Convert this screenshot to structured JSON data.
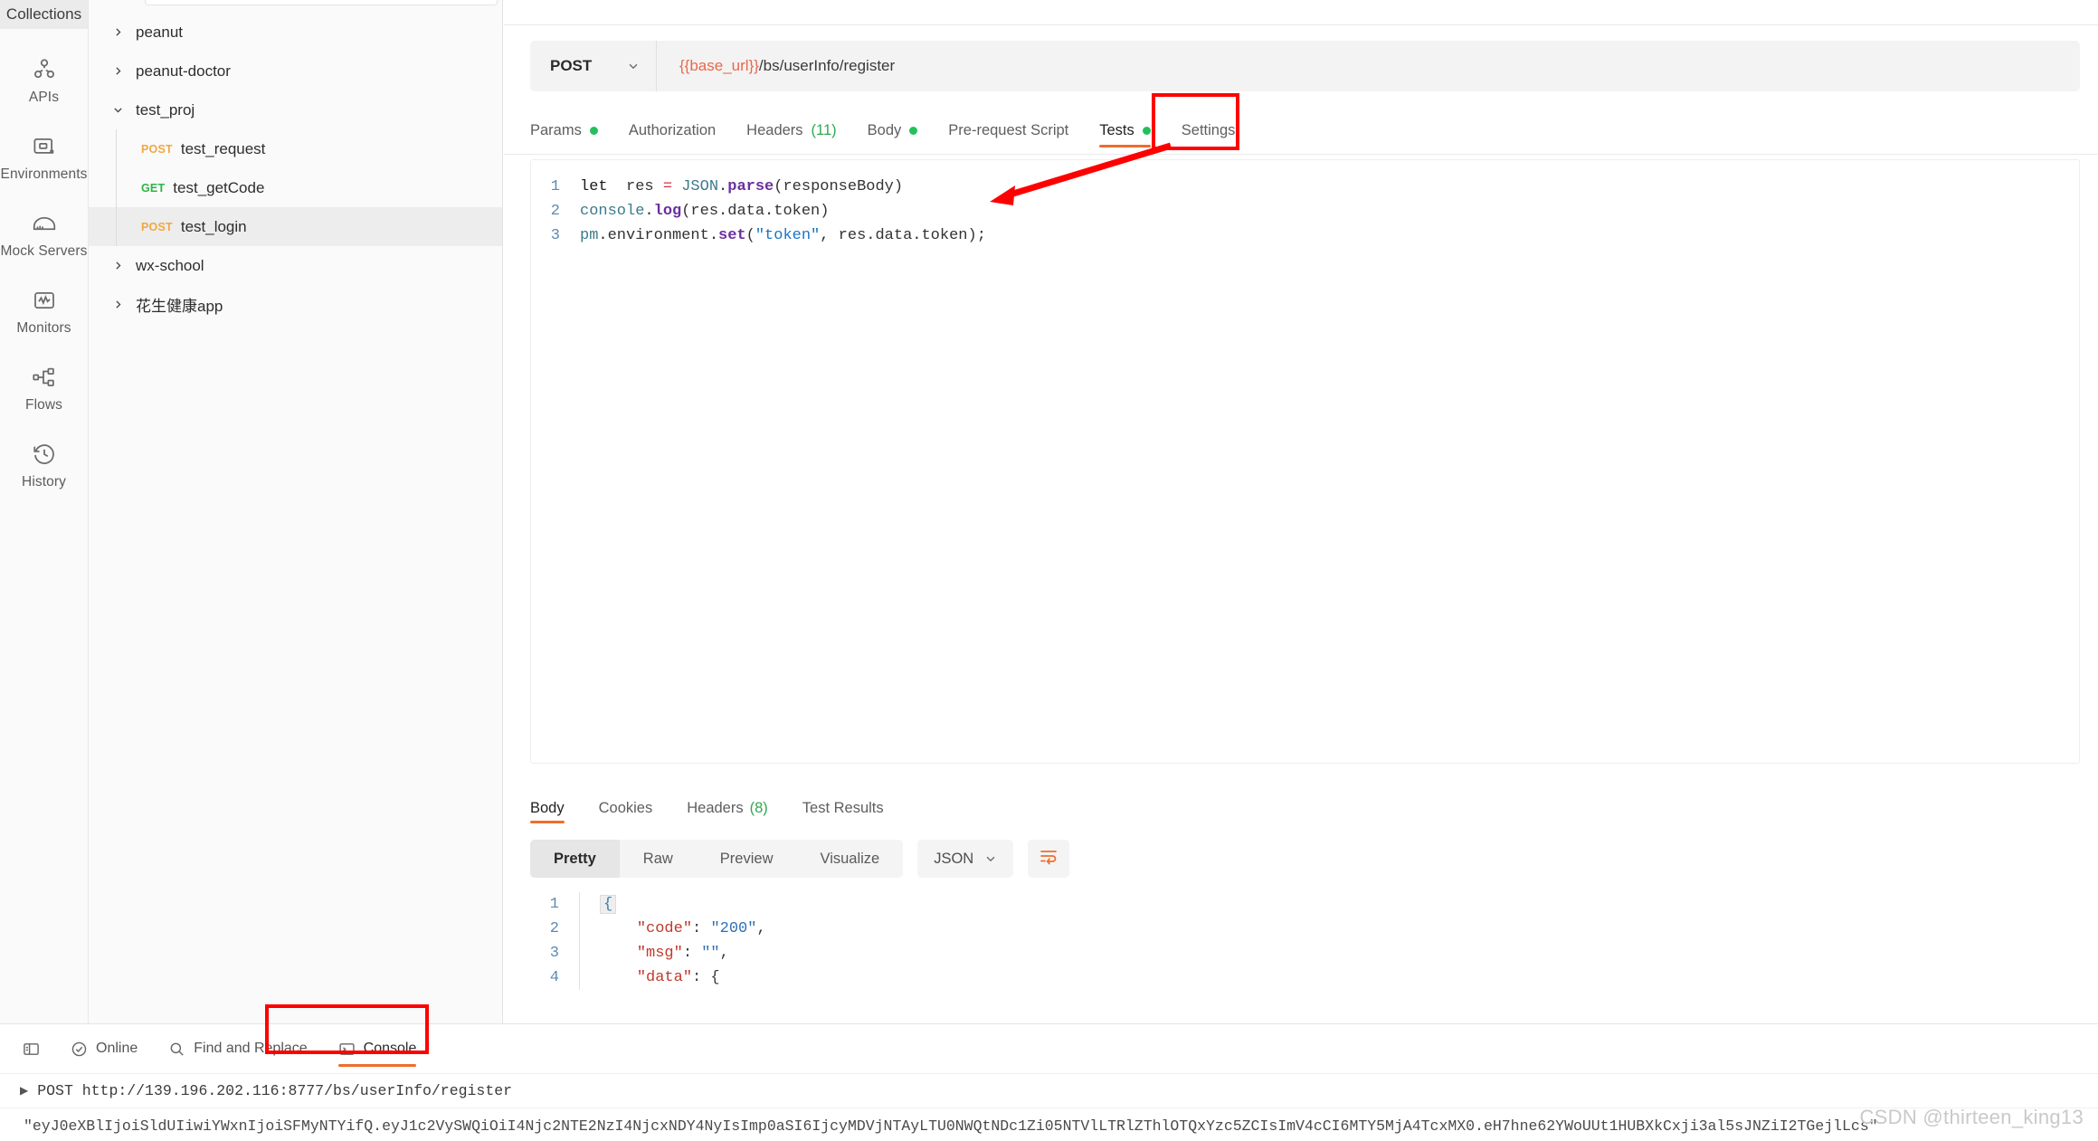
{
  "rail": {
    "header": "Collections",
    "items": [
      {
        "label": "APIs",
        "icon": "apis-icon"
      },
      {
        "label": "Environments",
        "icon": "environments-icon"
      },
      {
        "label": "Mock Servers",
        "icon": "mock-servers-icon"
      },
      {
        "label": "Monitors",
        "icon": "monitors-icon"
      },
      {
        "label": "Flows",
        "icon": "flows-icon"
      },
      {
        "label": "History",
        "icon": "history-icon"
      }
    ]
  },
  "sidebar": {
    "tree": [
      {
        "label": "peanut",
        "type": "collection",
        "expanded": false
      },
      {
        "label": "peanut-doctor",
        "type": "collection",
        "expanded": false
      },
      {
        "label": "test_proj",
        "type": "collection",
        "expanded": true
      },
      {
        "label": "test_request",
        "type": "request",
        "method": "POST",
        "selected": false
      },
      {
        "label": "test_getCode",
        "type": "request",
        "method": "GET",
        "selected": false
      },
      {
        "label": "test_login",
        "type": "request",
        "method": "POST",
        "selected": true
      },
      {
        "label": "wx-school",
        "type": "collection",
        "expanded": false
      },
      {
        "label": "花生健康app",
        "type": "collection",
        "expanded": false
      }
    ]
  },
  "request": {
    "method": "POST",
    "url_variable": "{{base_url}}",
    "url_path": "/bs/userInfo/register",
    "tabs": [
      {
        "label": "Params",
        "badge": "dot",
        "active": false
      },
      {
        "label": "Authorization",
        "badge": "none",
        "active": false
      },
      {
        "label": "Headers",
        "count": "(11)",
        "badge": "count",
        "active": false
      },
      {
        "label": "Body",
        "badge": "dot",
        "active": false
      },
      {
        "label": "Pre-request Script",
        "badge": "none",
        "active": false
      },
      {
        "label": "Tests",
        "badge": "dot",
        "active": true
      },
      {
        "label": "Settings",
        "badge": "none",
        "active": false
      }
    ],
    "script_lines": [
      {
        "n": "1",
        "tokens": [
          {
            "t": "let  ",
            "c": "k-kw"
          },
          {
            "t": "res ",
            "c": "k-pl"
          },
          {
            "t": "= ",
            "c": "k-op"
          },
          {
            "t": "JSON",
            "c": "k-obj"
          },
          {
            "t": ".",
            "c": "k-pl"
          },
          {
            "t": "parse",
            "c": "k-fn"
          },
          {
            "t": "(responseBody)",
            "c": "k-pl"
          }
        ]
      },
      {
        "n": "2",
        "tokens": [
          {
            "t": "console",
            "c": "k-obj"
          },
          {
            "t": ".",
            "c": "k-pl"
          },
          {
            "t": "log",
            "c": "k-fn"
          },
          {
            "t": "(res.data.token)",
            "c": "k-pl"
          }
        ]
      },
      {
        "n": "3",
        "tokens": [
          {
            "t": "pm",
            "c": "k-obj"
          },
          {
            "t": ".environment.",
            "c": "k-pl"
          },
          {
            "t": "set",
            "c": "k-fn"
          },
          {
            "t": "(",
            "c": "k-pl"
          },
          {
            "t": "\"token\"",
            "c": "k-str"
          },
          {
            "t": ", res.data.token);",
            "c": "k-pl"
          }
        ]
      }
    ]
  },
  "response": {
    "tabs": [
      {
        "label": "Body",
        "active": true
      },
      {
        "label": "Cookies",
        "active": false
      },
      {
        "label": "Headers",
        "count": "(8)",
        "active": false
      },
      {
        "label": "Test Results",
        "active": false
      }
    ],
    "view_modes": [
      "Pretty",
      "Raw",
      "Preview",
      "Visualize"
    ],
    "active_view_mode": "Pretty",
    "format": "JSON",
    "wrap_icon": "word-wrap-icon",
    "body_lines": [
      {
        "n": "1",
        "tokens": [
          {
            "t": "{",
            "c": "fold"
          }
        ]
      },
      {
        "n": "2",
        "tokens": [
          {
            "t": "    ",
            "c": "j-pun"
          },
          {
            "t": "\"code\"",
            "c": "j-key"
          },
          {
            "t": ": ",
            "c": "j-pun"
          },
          {
            "t": "\"200\"",
            "c": "j-str"
          },
          {
            "t": ",",
            "c": "j-pun"
          }
        ]
      },
      {
        "n": "3",
        "tokens": [
          {
            "t": "    ",
            "c": "j-pun"
          },
          {
            "t": "\"msg\"",
            "c": "j-key"
          },
          {
            "t": ": ",
            "c": "j-pun"
          },
          {
            "t": "\"\"",
            "c": "j-str"
          },
          {
            "t": ",",
            "c": "j-pun"
          }
        ]
      },
      {
        "n": "4",
        "tokens": [
          {
            "t": "    ",
            "c": "j-pun"
          },
          {
            "t": "\"data\"",
            "c": "j-key"
          },
          {
            "t": ": {",
            "c": "j-pun"
          }
        ]
      }
    ]
  },
  "statusbar": {
    "items": [
      {
        "label": "",
        "icon": "sidebar-toggle-icon",
        "active": false
      },
      {
        "label": "Online",
        "icon": "online-check-icon",
        "active": false
      },
      {
        "label": "Find and Replace",
        "icon": "search-icon",
        "active": false
      },
      {
        "label": "Console",
        "icon": "console-icon",
        "active": true
      }
    ]
  },
  "console": {
    "request_line": "POST http://139.196.202.116:8777/bs/userInfo/register",
    "token_line": "\"eyJ0eXBlIjoiSldUIiwiYWxnIjoiSFMyNTYifQ.eyJ1c2VySWQiOiI4Njc2NTE2NzI4NjcxNDY4NyIsImp0aSI6IjcyMDVjNTAyLTU0NWQtNDc1Zi05NTVlLTRlZThlOTQxYzc5ZCIsImV4cCI6MTY5MjA4TcxMX0.eH7hne62YWoUUt1HUBXkCxji3al5sJNZiI2TGejlLcs\""
  },
  "watermark": "CSDN @thirteen_king13",
  "colors": {
    "accent": "#f06c2d",
    "annotation": "#ff0000",
    "green_dot": "#25c05b",
    "post": "#f0a842",
    "get": "#2fb344",
    "variable": "#e8694a"
  }
}
